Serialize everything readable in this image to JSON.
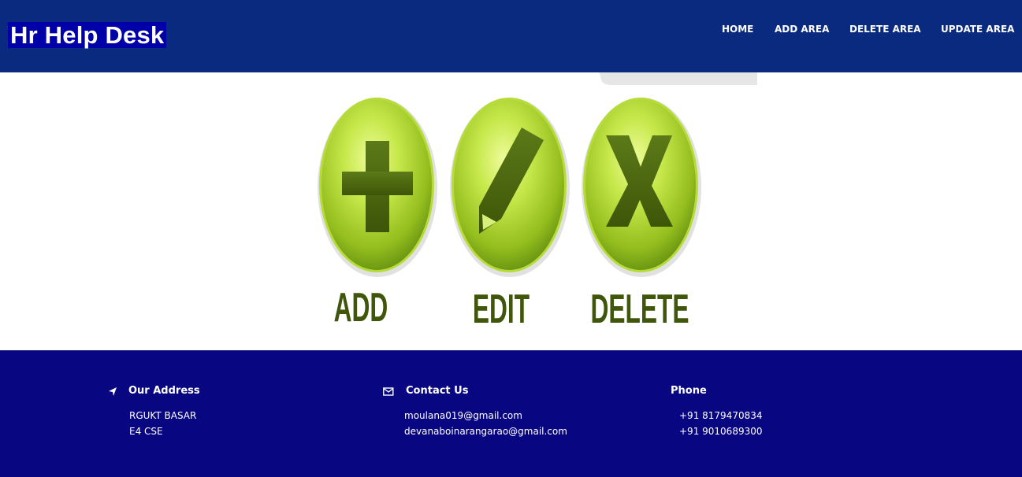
{
  "header": {
    "brand": "Hr Help Desk",
    "nav": [
      {
        "label": "HOME"
      },
      {
        "label": "ADD AREA"
      },
      {
        "label": "DELETE AREA"
      },
      {
        "label": "UPDATE AREA"
      }
    ]
  },
  "hero": {
    "captions": {
      "add": "ADD",
      "edit": "EDIT",
      "delete": "DELETE"
    },
    "colors": {
      "button_light": "#d4f26a",
      "button_mid": "#9cc322",
      "button_dark": "#5d8a10",
      "glyph": "#4a6410",
      "caption": "#3f560b"
    }
  },
  "footer": {
    "address": {
      "icon": "location-arrow-icon",
      "title": "Our Address",
      "lines": [
        "RGUKT BASAR",
        "E4 CSE"
      ]
    },
    "contact": {
      "icon": "envelope-icon",
      "title": "Contact Us",
      "lines": [
        "moulana019@gmail.com",
        "devanaboinarangarao@gmail.com"
      ]
    },
    "phone": {
      "title": "Phone",
      "lines": [
        "+91 8179470834",
        "+91 9010689300"
      ]
    }
  },
  "colors": {
    "header_bg": "#0a2a80",
    "brand_bg": "#0000a8",
    "footer_bg": "#080680",
    "text": "#ffffff"
  }
}
